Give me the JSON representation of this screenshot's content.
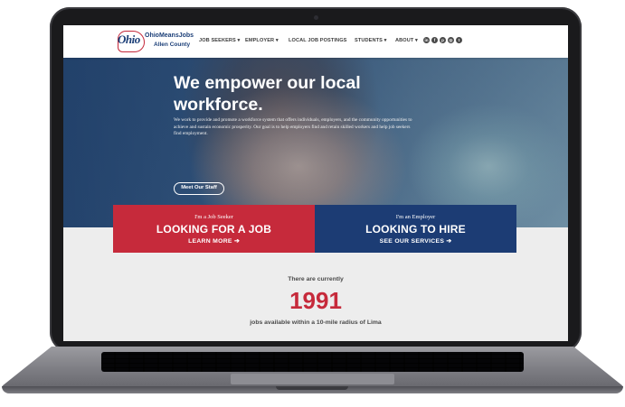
{
  "nav": {
    "logo_brand": "OhioMeansJobs",
    "logo_county": "Allen County",
    "logo_ohio": "Ohio",
    "items": [
      {
        "label": "JOB SEEKERS ▾"
      },
      {
        "label": "EMPLOYER ▾"
      },
      {
        "label": "LOCAL JOB POSTINGS"
      },
      {
        "label": "STUDENTS ▾"
      },
      {
        "label": "ABOUT ▾"
      }
    ],
    "social_icons": [
      "linkedin-icon",
      "facebook-icon",
      "pinterest-icon",
      "instagram-icon",
      "twitter-icon"
    ]
  },
  "hero": {
    "title": "We empower our local workforce.",
    "body": "We work to provide and promote a workforce system that offers individuals, employers, and the community opportunities to achieve and sustain economic prosperity. Our goal is to help employers find and retain skilled workers and help job seekers find employment.",
    "button_label": "Meet Our Staff"
  },
  "cta": {
    "job_seeker": {
      "kicker": "I'm a Job Seeker",
      "headline": "LOOKING FOR A JOB",
      "link": "LEARN MORE ➔"
    },
    "employer": {
      "kicker": "I'm an Employer",
      "headline": "LOOKING TO HIRE",
      "link": "SEE OUR SERVICES ➔"
    }
  },
  "jobs": {
    "intro": "There are currently",
    "count": "1991",
    "caption": "jobs available within a 10-mile radius of Lima"
  },
  "colors": {
    "brand_red": "#c62a3b",
    "brand_blue": "#1c3c74",
    "nav_text": "#3d3d3d"
  }
}
